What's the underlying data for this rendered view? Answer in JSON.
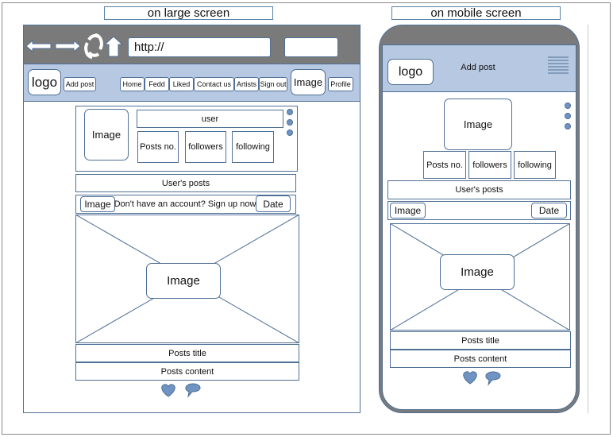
{
  "captions": {
    "large": "on large screen",
    "mobile": "on mobile screen"
  },
  "desktop": {
    "address": "http://",
    "logo": "logo",
    "add_post": "Add post",
    "nav": [
      "Home",
      "Fedd",
      "Liked",
      "Contact us",
      "Artists",
      "Sign out"
    ],
    "nav_image": "Image",
    "profile": "Profile",
    "profile_card": {
      "image": "Image",
      "user": "user",
      "posts_no": "Posts no.",
      "followers": "followers",
      "following": "following"
    },
    "users_posts": "User's posts",
    "post_bar": {
      "image": "Image",
      "text": "Don't have an account?  Sign up now",
      "date": "Date"
    },
    "post_image": "Image",
    "posts_title": "Posts title",
    "posts_content": "Posts content"
  },
  "mobile": {
    "logo": "logo",
    "add_post": "Add post",
    "profile_card": {
      "image": "Image",
      "posts_no": "Posts no.",
      "followers": "followers",
      "following": "following"
    },
    "users_posts": "User's posts",
    "post_bar": {
      "image": "Image",
      "date": "Date"
    },
    "post_image": "Image",
    "posts_title": "Posts title",
    "posts_content": "Posts content"
  },
  "colors": {
    "chrome": "#7a7a7a",
    "header": "#b7c9e2",
    "accent": "#6f94c4",
    "stroke": "#4f6f96"
  }
}
